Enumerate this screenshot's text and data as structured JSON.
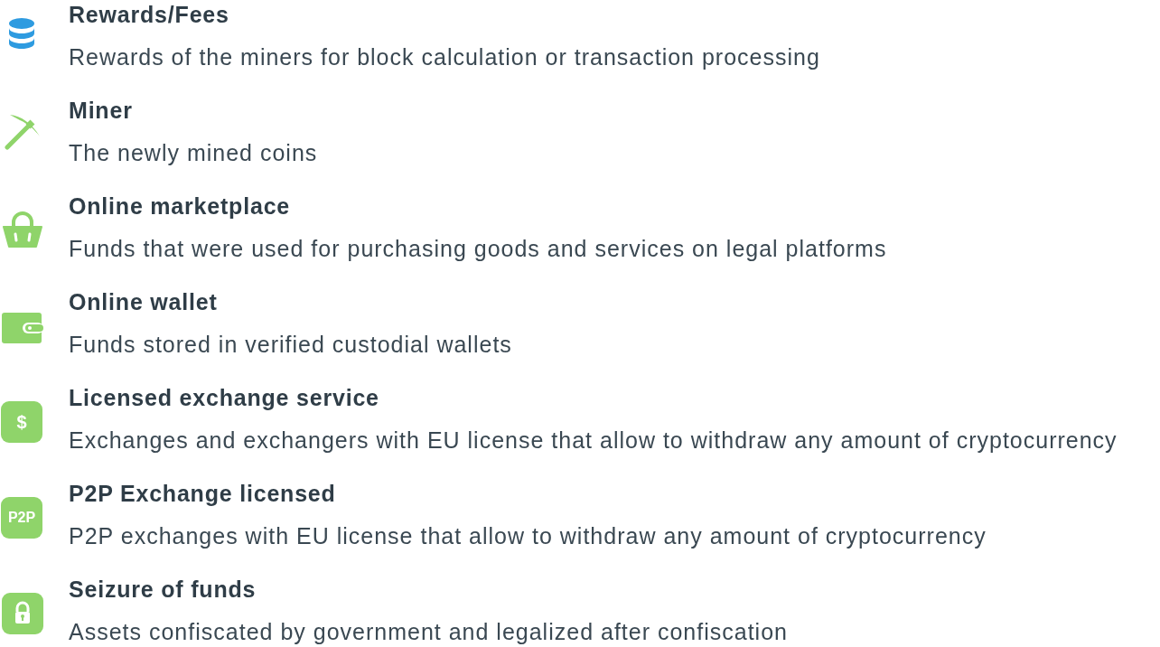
{
  "items": [
    {
      "kind": "database",
      "title": "Rewards/Fees",
      "description": "Rewards of the miners for block calculation or transaction processing"
    },
    {
      "kind": "pickaxe",
      "title": "Miner",
      "description": "The newly mined coins"
    },
    {
      "kind": "basket",
      "title": "Online marketplace",
      "description": "Funds that were used for purchasing goods and services on legal platforms"
    },
    {
      "kind": "wallet",
      "title": "Online wallet",
      "description": "Funds stored in verified custodial wallets"
    },
    {
      "kind": "badge",
      "icon_text": "$",
      "title": "Licensed exchange service",
      "description": "Exchanges and exchangers with EU license that allow to withdraw any amount of cryptocurrency"
    },
    {
      "kind": "badge",
      "icon_text": "P2P",
      "title": "P2P Exchange licensed",
      "description": "P2P exchanges with EU license that allow to withdraw any amount of cryptocurrency"
    },
    {
      "kind": "lock",
      "title": "Seizure of funds",
      "description": "Assets confiscated by government and legalized after confiscation"
    }
  ]
}
